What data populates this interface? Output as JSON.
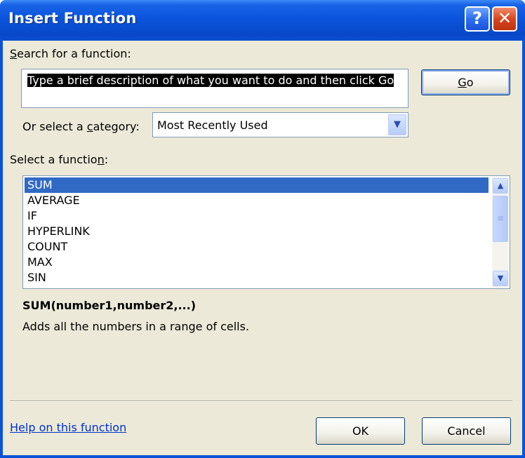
{
  "window": {
    "title": "Insert Function",
    "help_glyph": "?",
    "close_glyph": "✕"
  },
  "search": {
    "label_first": "S",
    "label_rest": "earch for a function:",
    "text": "Type a brief description of what you want to do and then click Go",
    "go_first": "G",
    "go_rest": "o"
  },
  "category": {
    "label_pre": "Or select a ",
    "label_u": "c",
    "label_post": "ategory:",
    "value": "Most Recently Used",
    "arrow": "▼"
  },
  "functions": {
    "label_pre": "Select a functio",
    "label_u": "n",
    "label_post": ":",
    "items": [
      "SUM",
      "AVERAGE",
      "IF",
      "HYPERLINK",
      "COUNT",
      "MAX",
      "SIN"
    ],
    "selected_index": 0
  },
  "scrollbar": {
    "up": "▲",
    "down": "▼",
    "grip": "≡"
  },
  "detail": {
    "signature": "SUM(number1,number2,...)",
    "description": "Adds all the numbers in a range of cells."
  },
  "footer": {
    "help_link": "Help on this function",
    "ok_label": "OK",
    "cancel_label": "Cancel"
  },
  "colors": {
    "titlebar": "#0a54dc",
    "selection": "#316ac5",
    "dialog_bg": "#ece9d8",
    "link": "#0033cc"
  }
}
